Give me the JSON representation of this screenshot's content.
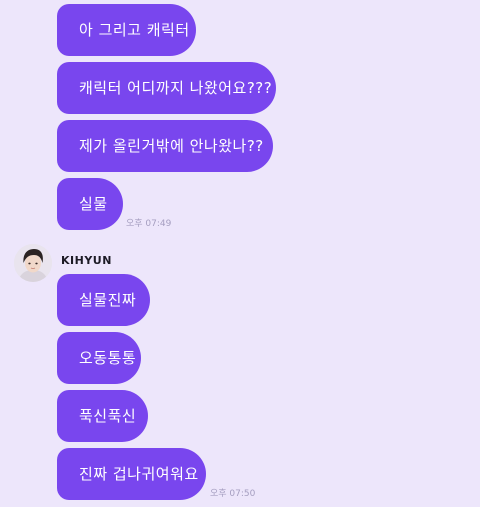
{
  "conversation": {
    "first_group": {
      "messages": [
        "아 그리고 캐릭터",
        "캐릭터 어디까지 나왔어요???",
        "제가 올린거밖에 안나왔나??",
        "실물"
      ],
      "time": "오후 07:49"
    },
    "sender": {
      "name": "KIHYUN"
    },
    "second_group": {
      "messages": [
        "실물진짜",
        "오동통통",
        "푹신푹신",
        "진짜 겁나귀여워요"
      ],
      "time": "오후 07:50"
    }
  },
  "colors": {
    "background": "#ede6fb",
    "bubble": "#7946ee",
    "bubble_text": "#ffffff",
    "timestamp": "#a59ec0"
  }
}
